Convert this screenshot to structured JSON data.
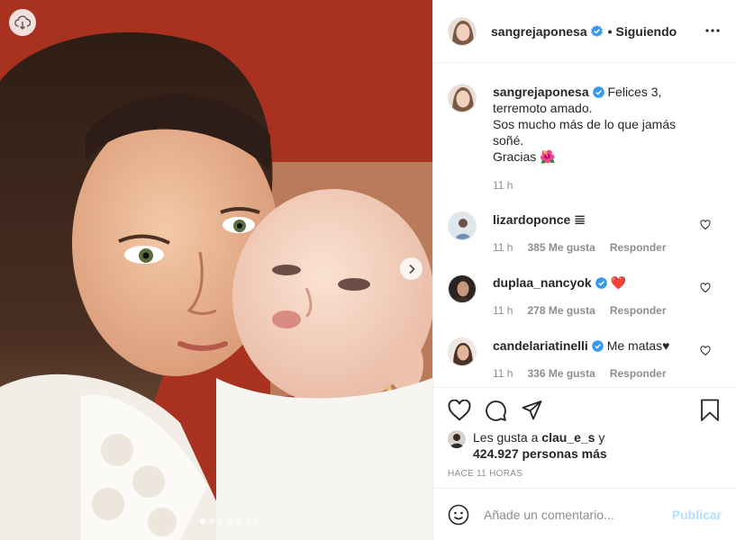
{
  "post": {
    "author": "sangrejaponesa",
    "follow_status": "Siguiendo",
    "separator": "•",
    "carousel": {
      "slide_count": 7,
      "active_index": 0
    },
    "caption": {
      "username": "sangrejaponesa",
      "lines": [
        "Felices 3,",
        "terremoto amado.",
        "Sos mucho más de lo que jamás",
        "soñé.",
        "Gracias 🌺"
      ],
      "time": "11 h"
    },
    "comments": [
      {
        "username": "lizardoponce",
        "text": "𝌆",
        "time": "11 h",
        "likes": "385 Me gusta",
        "reply": "Responder"
      },
      {
        "username": "duplaa_nancyok",
        "text": "❤️",
        "time": "11 h",
        "likes": "278 Me gusta",
        "reply": "Responder"
      },
      {
        "username": "candelariatinelli",
        "text": "Me matas♥",
        "time": "11 h",
        "likes": "336 Me gusta",
        "reply": "Responder"
      }
    ],
    "likes_line": {
      "prefix": "Les gusta a ",
      "user": "clau_e_s",
      "joiner": " y",
      "count": "424.927 personas más"
    },
    "posted_ago": "HACE 11 HORAS",
    "comment_input": {
      "placeholder": "Añade un comentario...",
      "submit": "Publicar"
    }
  },
  "colors": {
    "verified": "#3897f0",
    "heart_red": "#ed4956",
    "publish_disabled": "#b2dffc",
    "muted": "#8e8e8e"
  },
  "icons": [
    "download-icon",
    "chevron-right-icon",
    "more-options-icon",
    "verified-badge-icon",
    "heart-icon",
    "comment-icon",
    "share-icon",
    "bookmark-icon",
    "emoji-icon"
  ]
}
